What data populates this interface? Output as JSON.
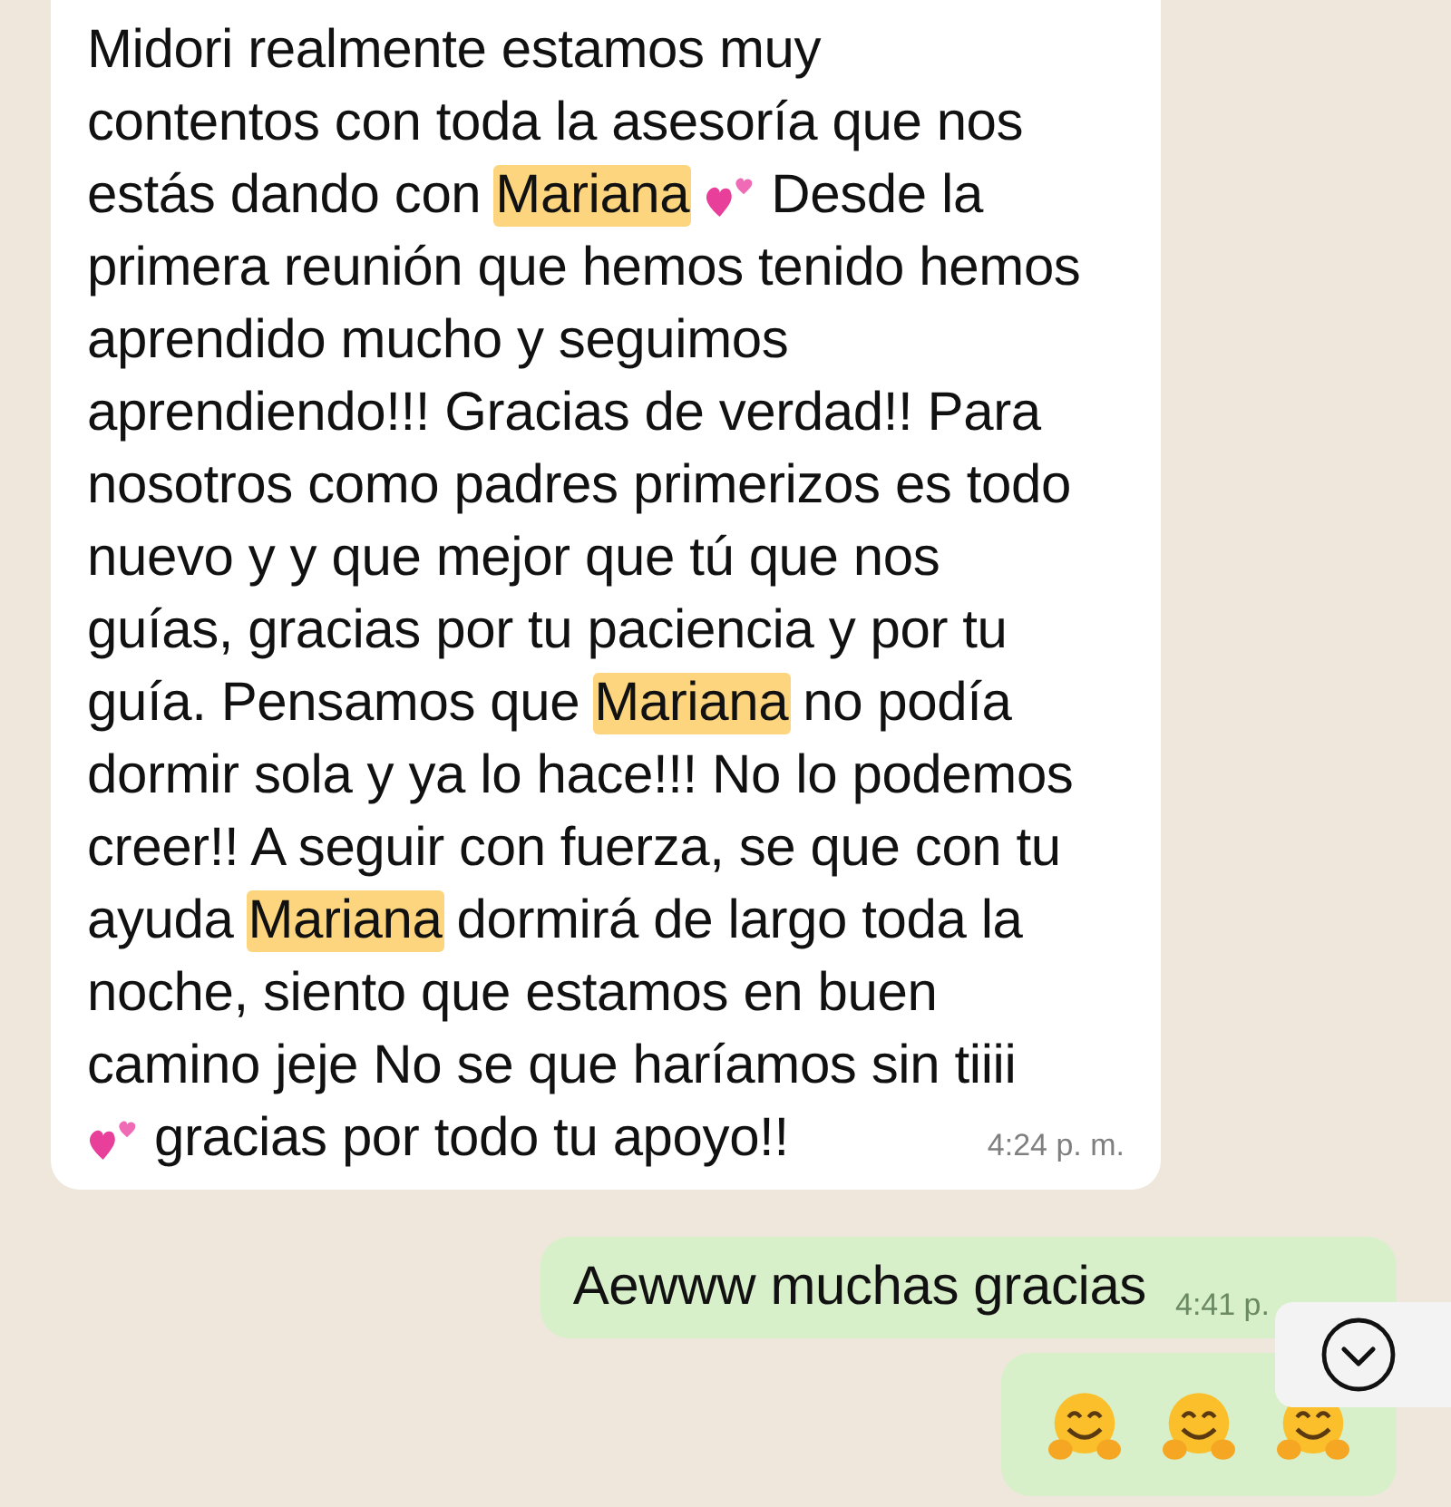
{
  "messages": [
    {
      "kind": "incoming",
      "lines": [
        [
          {
            "kind": "text",
            "text": "Midori realmente estamos muy"
          }
        ],
        [
          {
            "kind": "text",
            "text": "contentos con toda la asesoría que nos"
          }
        ],
        [
          {
            "kind": "text",
            "text": "estás dando con"
          },
          {
            "kind": "mention",
            "text": "Mariana"
          },
          {
            "kind": "hearts"
          },
          {
            "kind": "text",
            "text": "Desde la"
          }
        ],
        [
          {
            "kind": "text",
            "text": "primera reunión que hemos tenido hemos"
          }
        ],
        [
          {
            "kind": "text",
            "text": "aprendido mucho y seguimos"
          }
        ],
        [
          {
            "kind": "text",
            "text": "aprendiendo!!! Gracias de verdad!! Para"
          }
        ],
        [
          {
            "kind": "text",
            "text": "nosotros como padres primerizos es todo"
          }
        ],
        [
          {
            "kind": "text",
            "text": "nuevo y y que mejor que tú que nos"
          }
        ],
        [
          {
            "kind": "text",
            "text": "guías, gracias por tu paciencia y por tu"
          }
        ],
        [
          {
            "kind": "text",
            "text": "guía. Pensamos que"
          },
          {
            "kind": "mention",
            "text": "Mariana"
          },
          {
            "kind": "text",
            "text": "no podía"
          }
        ],
        [
          {
            "kind": "text",
            "text": "dormir sola y ya lo hace!!! No lo podemos"
          }
        ],
        [
          {
            "kind": "text",
            "text": "creer!! A seguir con fuerza, se que con tu"
          }
        ],
        [
          {
            "kind": "text",
            "text": "ayuda"
          },
          {
            "kind": "mention",
            "text": "Mariana"
          },
          {
            "kind": "text",
            "text": "dormirá de largo toda la"
          }
        ],
        [
          {
            "kind": "text",
            "text": "noche, siento que estamos en buen"
          }
        ],
        [
          {
            "kind": "text",
            "text": "camino jeje No se que haríamos sin tiiii"
          }
        ],
        [
          {
            "kind": "hearts"
          },
          {
            "kind": "text",
            "text": "gracias por todo tu apoyo!!"
          }
        ]
      ],
      "time": "4:24 p. m."
    },
    {
      "kind": "outgoing",
      "lines": [
        [
          {
            "kind": "text",
            "text": "Aewww muchas gracias"
          }
        ]
      ],
      "time": "4:41 p."
    },
    {
      "kind": "outgoing",
      "lines": [
        [
          {
            "kind": "hug"
          },
          {
            "kind": "hug"
          },
          {
            "kind": "hug"
          }
        ]
      ]
    }
  ],
  "scroll_button": {
    "visible": true
  }
}
